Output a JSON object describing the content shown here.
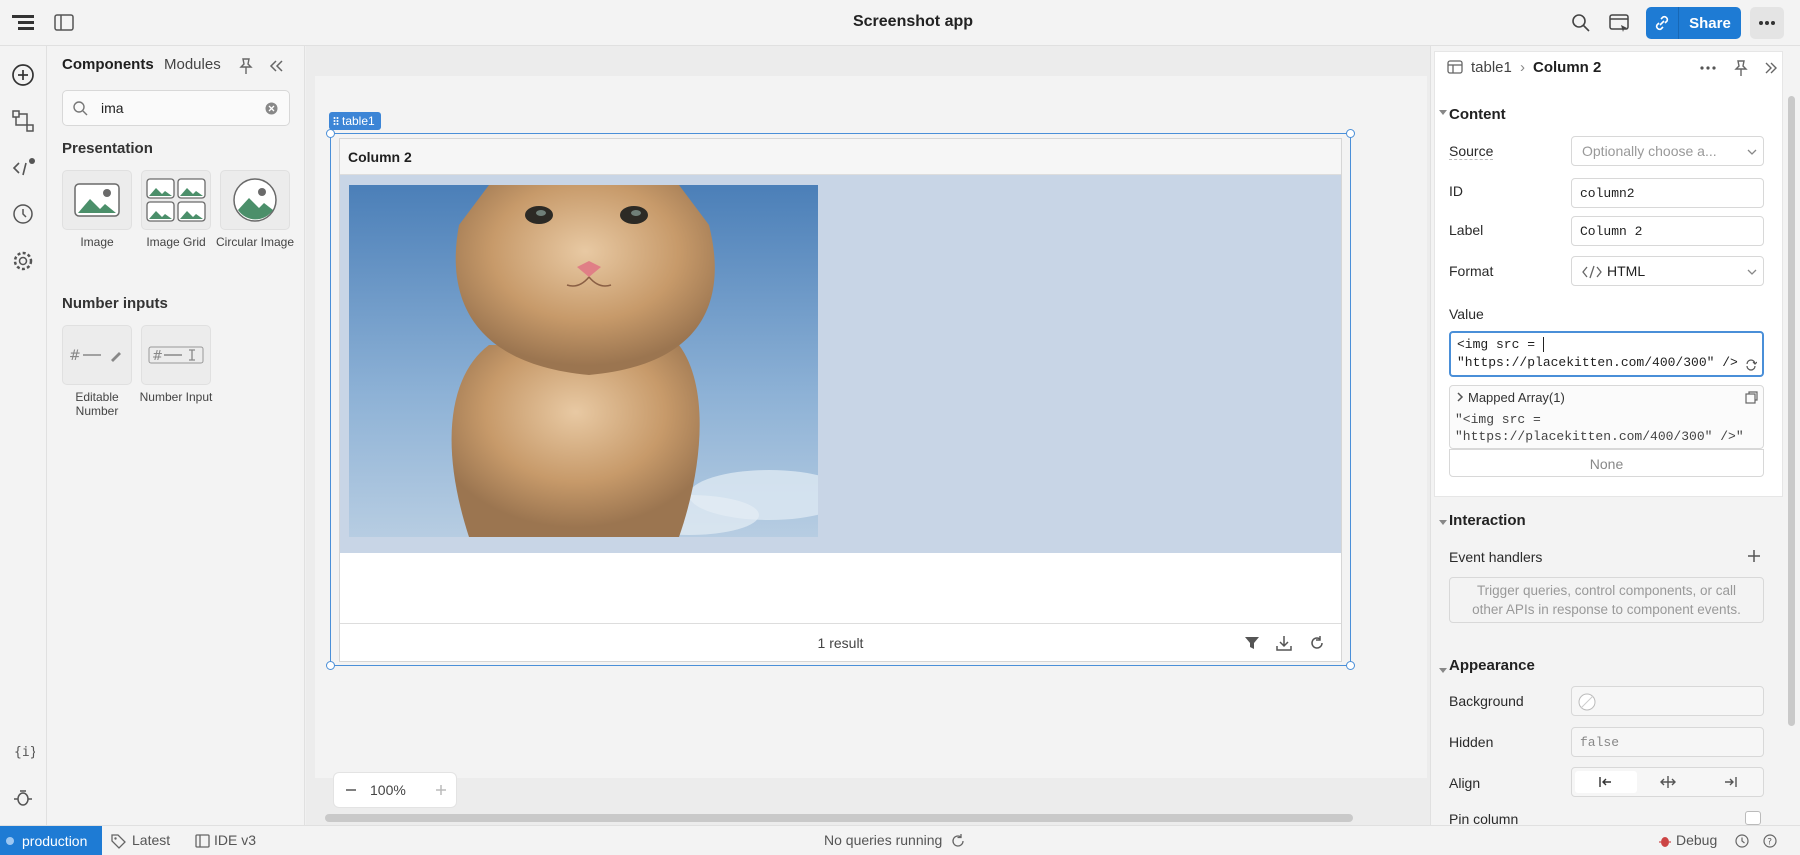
{
  "app": {
    "title": "Screenshot app"
  },
  "header": {
    "share_label": "Share",
    "more_icon": "ellipsis-icon"
  },
  "components_panel": {
    "tabs": [
      "Components",
      "Modules"
    ],
    "search_value": "ima",
    "sections": [
      {
        "title": "Presentation",
        "items": [
          "Image",
          "Image Grid",
          "Circular Image"
        ]
      },
      {
        "title": "Number inputs",
        "items": [
          "Editable Number",
          "Number Input"
        ]
      }
    ]
  },
  "canvas": {
    "component_tag": "table1",
    "table": {
      "column_header": "Column 2",
      "cell_image": "kitten photo",
      "footer_text": "1 result"
    },
    "zoom": "100%"
  },
  "inspector": {
    "breadcrumb": {
      "parent": "table1",
      "current": "Column 2"
    },
    "content": {
      "title": "Content",
      "source_label": "Source",
      "source_placeholder": "Optionally choose a...",
      "id_label": "ID",
      "id_value": "column2",
      "label_label": "Label",
      "label_value": "Column 2",
      "format_label": "Format",
      "format_value": "HTML",
      "value_label": "Value",
      "value_line1": "<img src = ",
      "value_line2": "\"https://placekitten.com/400/300\" />",
      "mapped_title": "Mapped Array(1)",
      "mapped_line1": "\"<img src =",
      "mapped_line2": "\"https://placekitten.com/400/300\" />\"",
      "none_label": "None"
    },
    "interaction": {
      "title": "Interaction",
      "event_handlers_label": "Event handlers",
      "event_handlers_hint": "Trigger queries, control components, or call other APIs in response to component events."
    },
    "appearance": {
      "title": "Appearance",
      "background_label": "Background",
      "hidden_label": "Hidden",
      "hidden_value": "false",
      "align_label": "Align",
      "pin_label": "Pin column"
    }
  },
  "statusbar": {
    "environment": "production",
    "version": "Latest",
    "ide": "IDE v3",
    "queries": "No queries running",
    "debug": "Debug"
  },
  "colors": {
    "accent": "#1e7bd4",
    "selection": "#4a8fd8"
  }
}
